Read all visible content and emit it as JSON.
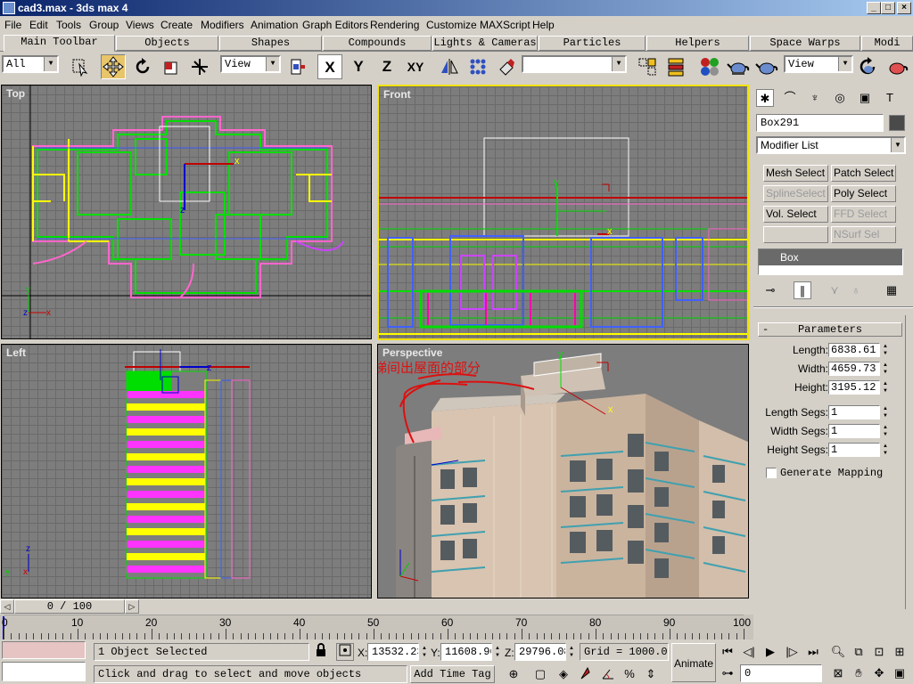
{
  "window": {
    "title": "cad3.max - 3ds max 4",
    "minimize": "_",
    "maximize": "□",
    "close": "×"
  },
  "menu": [
    {
      "label": "File"
    },
    {
      "label": "Edit"
    },
    {
      "label": "Tools"
    },
    {
      "label": "Group"
    },
    {
      "label": "Views"
    },
    {
      "label": "Create"
    },
    {
      "label": "Modifiers"
    },
    {
      "label": "Animation"
    },
    {
      "label": "Graph Editors"
    },
    {
      "label": "Rendering"
    },
    {
      "label": "Customize"
    },
    {
      "label": "MAXScript"
    },
    {
      "label": "Help"
    }
  ],
  "tabs": [
    "Main Toolbar",
    "Objects",
    "Shapes",
    "Compounds",
    "Lights & Cameras",
    "Particles",
    "Helpers",
    "Space Warps",
    "Modi"
  ],
  "toolbar": {
    "selection_filter": "All",
    "ref_coord_1": "View",
    "ref_coord_2": "View",
    "named_selection": "",
    "axis_x": "X",
    "axis_y": "Y",
    "axis_z": "Z",
    "axis_xy": "XY",
    "icons": [
      "select-region-icon",
      "move-icon",
      "rotate-icon",
      "scale-icon",
      "manipulate-icon",
      "mirror-icon",
      "array-icon",
      "align-icon",
      "material-editor-icon",
      "render-icon"
    ]
  },
  "viewports": {
    "top": "Top",
    "front": "Front",
    "left": "Left",
    "perspective": "Perspective",
    "annotation": "建立女儿墙和楼梯间出屋面的部分"
  },
  "command_panel": {
    "object_name": "Box291",
    "object_color": "#4a4a4a",
    "modifier_list": "Modifier List",
    "modifier_buttons": [
      {
        "label": "Mesh Select",
        "enabled": true
      },
      {
        "label": "Patch Select",
        "enabled": true
      },
      {
        "label": "SplineSelect",
        "enabled": false
      },
      {
        "label": "Poly Select",
        "enabled": true
      },
      {
        "label": "Vol. Select",
        "enabled": true
      },
      {
        "label": "FFD Select",
        "enabled": false
      },
      {
        "label": "",
        "enabled": false
      },
      {
        "label": "NSurf Sel",
        "enabled": false
      }
    ],
    "stack_item": "Box",
    "rollout_title": "Parameters",
    "rollout_toggle": "-",
    "params": [
      {
        "label": "Length:",
        "value": "6838.61"
      },
      {
        "label": "Width:",
        "value": "4659.73"
      },
      {
        "label": "Height:",
        "value": "3195.12"
      },
      {
        "label": "Length Segs:",
        "value": "1"
      },
      {
        "label": "Width Segs:",
        "value": "1"
      },
      {
        "label": "Height Segs:",
        "value": "1"
      }
    ],
    "generate_mapping": "Generate Mapping"
  },
  "timeline": {
    "frame_display": "0 / 100",
    "ticks": [
      "0",
      "10",
      "20",
      "30",
      "40",
      "50",
      "60",
      "70",
      "80",
      "90",
      "100"
    ]
  },
  "status": {
    "selection": "1 Object Selected",
    "prompt": "Click and drag to select and move objects",
    "x_label": "X:",
    "x": "13532.23",
    "y_label": "Y:",
    "y": "11608.96",
    "z_label": "Z:",
    "z": "29796.08",
    "grid": "Grid = 1000.0",
    "add_time_tag": "Add Time Tag",
    "animate": "Animate",
    "current_frame": "0"
  }
}
